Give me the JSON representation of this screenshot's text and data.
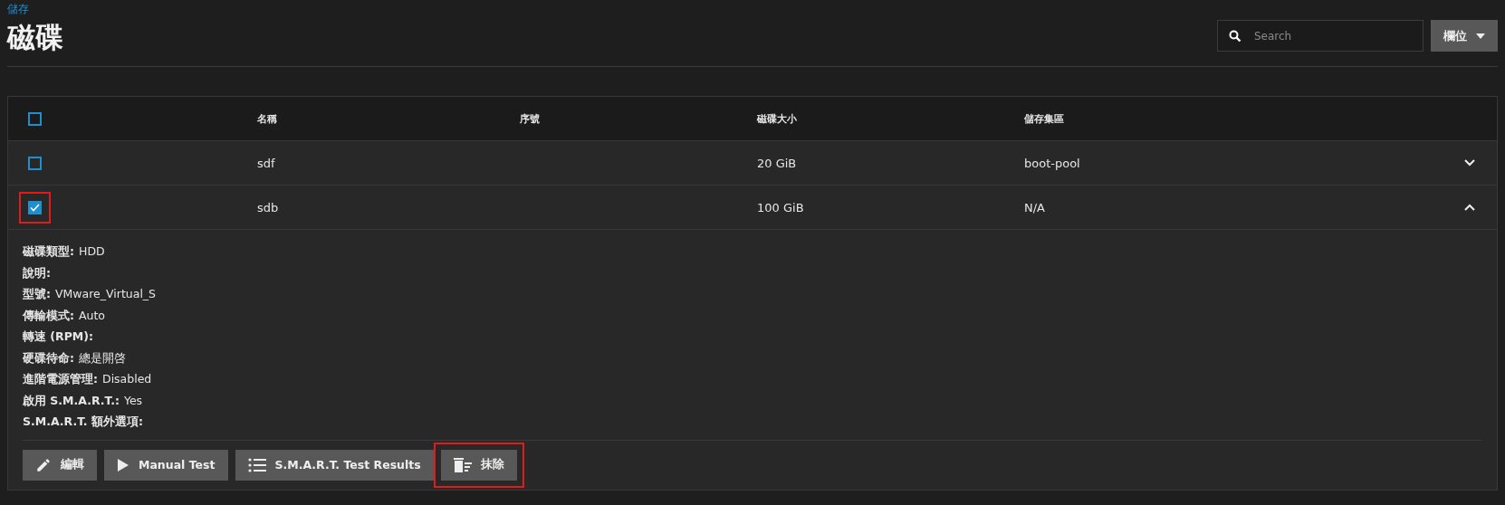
{
  "breadcrumb": "儲存",
  "title": "磁碟",
  "search": {
    "placeholder": "Search"
  },
  "columns_button": {
    "label": "欄位"
  },
  "table": {
    "select_all": {
      "checked": false
    },
    "columns": [
      "名稱",
      "序號",
      "磁碟大小",
      "儲存集區"
    ],
    "rows": [
      {
        "checked": false,
        "highlighted": false,
        "expanded": false,
        "cells": [
          "sdf",
          "",
          "20 GiB",
          "boot-pool"
        ]
      },
      {
        "checked": true,
        "highlighted": true,
        "expanded": true,
        "cells": [
          "sdb",
          "",
          "100 GiB",
          "N/A"
        ],
        "details": [
          {
            "label": "磁碟類型:",
            "value": "HDD"
          },
          {
            "label": "說明:"
          },
          {
            "label": "型號:",
            "value": "VMware_Virtual_S"
          },
          {
            "label": "傳輸模式:",
            "value": "Auto"
          },
          {
            "label": "轉速 (RPM):"
          },
          {
            "label": "硬碟待命:",
            "value": "總是開啓"
          },
          {
            "label": "進階電源管理:",
            "value": "Disabled"
          },
          {
            "label": "啟用 S.M.A.R.T.:",
            "value": "Yes"
          },
          {
            "label": "S.M.A.R.T. 額外選項:"
          }
        ],
        "actions": [
          {
            "kind": "edit",
            "label": "編輯",
            "highlighted": false
          },
          {
            "kind": "play",
            "label": "Manual Test",
            "highlighted": false
          },
          {
            "kind": "list",
            "label": "S.M.A.R.T. Test Results",
            "highlighted": false
          },
          {
            "kind": "wipe",
            "label": "抹除",
            "highlighted": true
          }
        ]
      }
    ]
  }
}
